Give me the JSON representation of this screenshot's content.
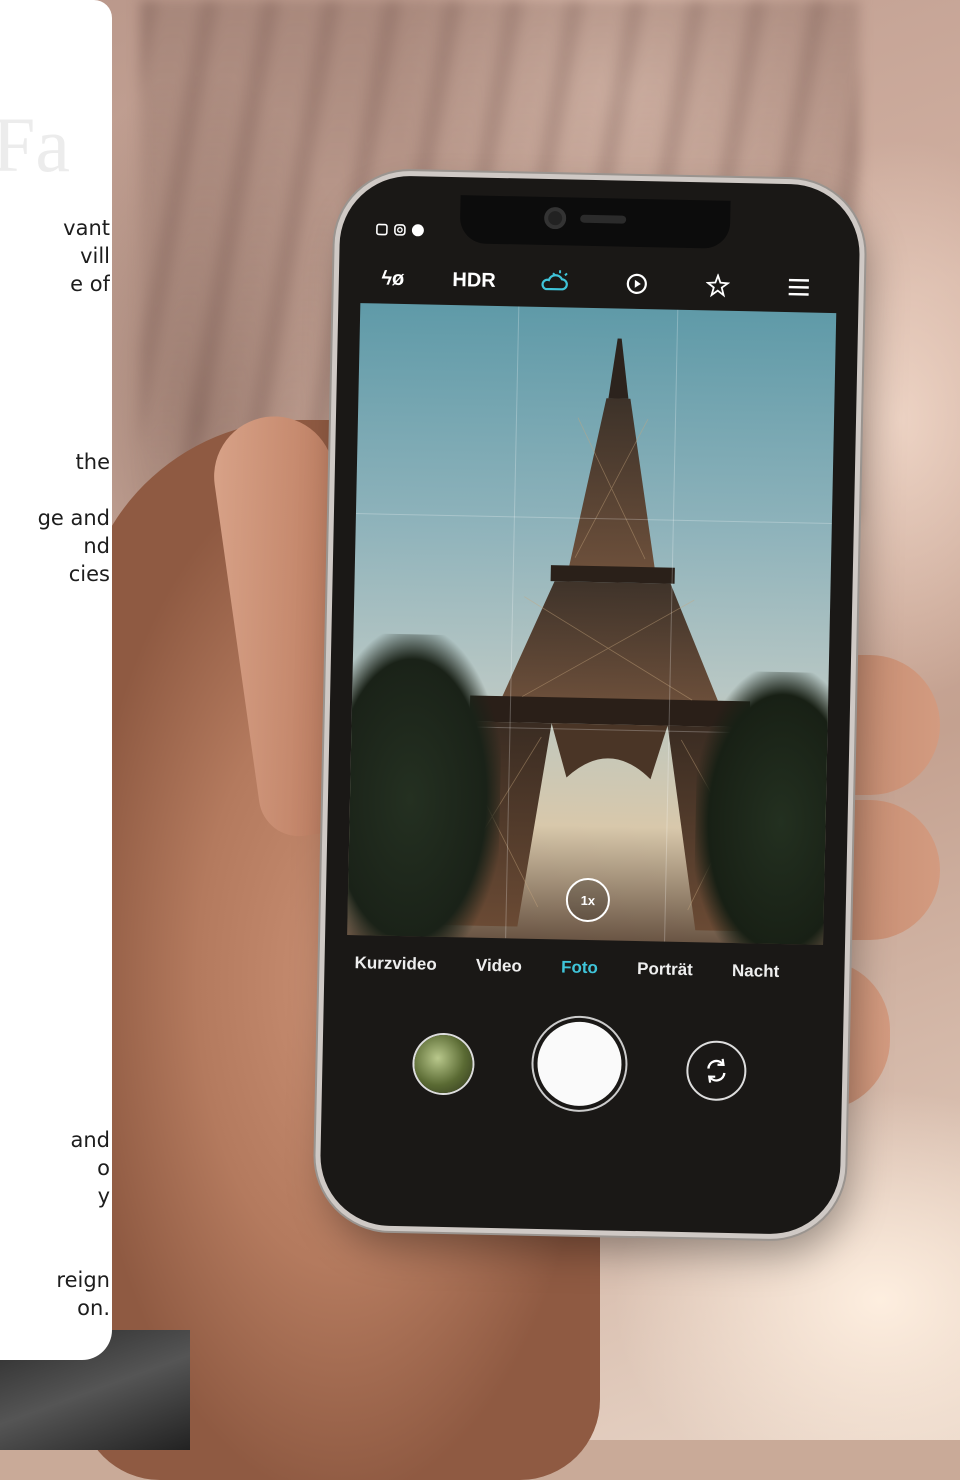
{
  "panel": {
    "ghost_title": "Fa",
    "lines_a": [
      "vant",
      "vill",
      "e of"
    ],
    "lines_b": [
      "the",
      "ge and",
      "nd",
      "cies"
    ],
    "lines_c": [
      "and",
      "o",
      "y"
    ],
    "lines_d": [
      "reign",
      "on."
    ]
  },
  "phone": {
    "toolbar": {
      "flash_label": "ϟø",
      "hdr_label": "HDR"
    },
    "zoom_label": "1x",
    "modes": [
      "Kurzvideo",
      "Video",
      "Foto",
      "Porträt",
      "Nacht"
    ],
    "active_mode": "Foto"
  },
  "colors": {
    "accent": "#3fc4d9",
    "panel_bg": "#ffffff",
    "phone_body": "#1a1816"
  }
}
